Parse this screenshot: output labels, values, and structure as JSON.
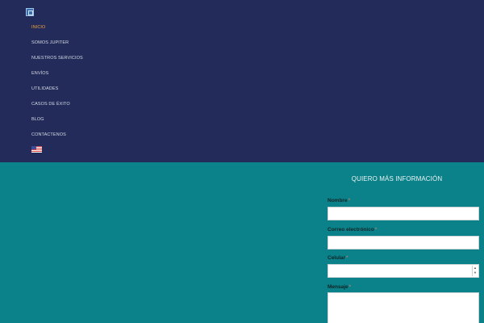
{
  "nav": {
    "items": [
      {
        "label": "INICIO",
        "active": true
      },
      {
        "label": "SOMOS JUPITER",
        "active": false
      },
      {
        "label": "NUESTROS SERVICIOS",
        "active": false
      },
      {
        "label": "ENVÍOS",
        "active": false
      },
      {
        "label": "UTILIDADES",
        "active": false
      },
      {
        "label": "CASOS DE ÉXITO",
        "active": false
      },
      {
        "label": "BLOG",
        "active": false
      },
      {
        "label": "CONTACTENOS",
        "active": false
      }
    ],
    "language_flag": "us-flag-icon"
  },
  "form": {
    "title": "QUIERO MÁS INFORMACIÓN",
    "fields": [
      {
        "label": "Nombre",
        "required_mark": "*"
      },
      {
        "label": "Correo electrónico",
        "required_mark": "*"
      },
      {
        "label": "Celular",
        "required_mark": "*"
      },
      {
        "label": "Mensaje",
        "required_mark": "*"
      }
    ]
  },
  "colors": {
    "header_bg": "#222b59",
    "body_bg": "#0b8189",
    "active_link": "#f2a23b",
    "required": "#f07a6e"
  }
}
